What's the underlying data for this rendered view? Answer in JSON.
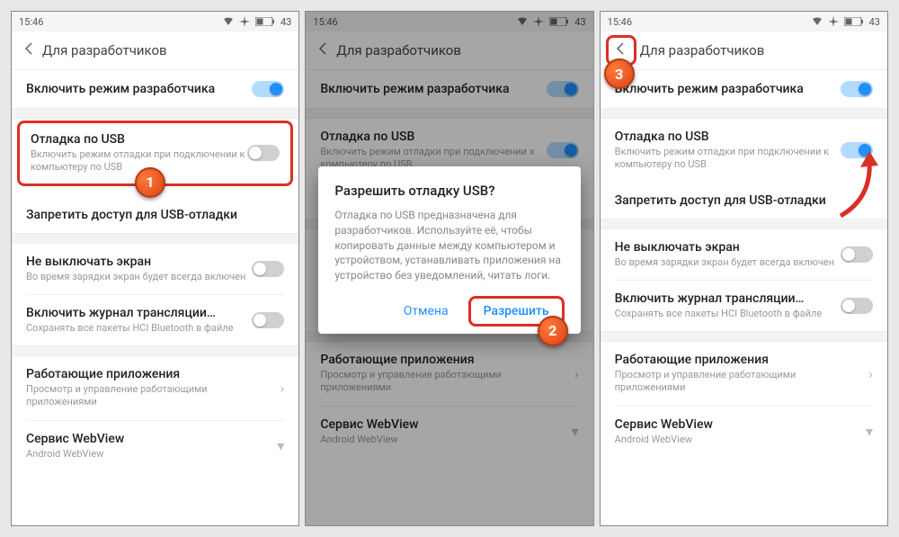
{
  "status": {
    "time": "15:46",
    "battery": "43"
  },
  "common": {
    "header_title": "Для разработчиков",
    "dev_mode": {
      "title": "Включить режим разработчика"
    },
    "usb_debug": {
      "title": "Отладка по USB",
      "sub": "Включить режим отладки при подключении к компьютеру по USB"
    },
    "deny_usb": {
      "title": "Запретить доступ для USB-отладки"
    },
    "keep_screen": {
      "title": "Не выключать экран",
      "sub": "Во время зарядки экран будет всегда включен"
    },
    "bt_log": {
      "title": "Включить журнал трансляции…",
      "sub": "Сохранять все пакеты HCI Bluetooth в файле"
    },
    "running": {
      "title": "Работающие приложения",
      "sub": "Просмотр и управление работающими приложениями"
    },
    "webview": {
      "title": "Сервис WebView",
      "sub": "Android WebView"
    }
  },
  "dialog": {
    "title": "Разрешить отладку USB?",
    "body": "Отладка по USB предназначена для разработчиков. Используйте её, чтобы копировать данные между компьютером и устройством, устанавливать приложения на устройство без уведомлений, читать логи.",
    "cancel": "Отмена",
    "allow": "Разрешить"
  },
  "steps": {
    "s1": "1",
    "s2": "2",
    "s3": "3"
  }
}
